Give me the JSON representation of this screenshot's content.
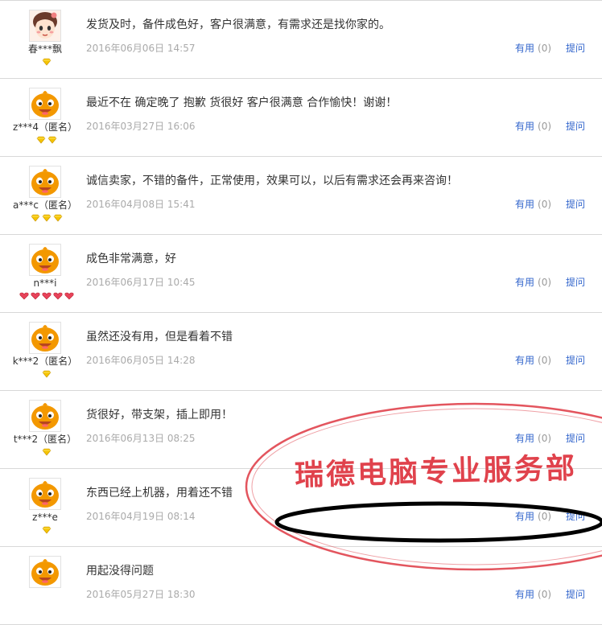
{
  "reviews": [
    {
      "avatar": "girl-avatar",
      "user": "春***飘",
      "content": "发货及时，备件成色好，客户很满意，有需求还是找你家的。",
      "time": "2016年06月06日 14:57",
      "useful_label": "有用",
      "useful_count": "(0)",
      "reply_label": "提问",
      "badge": "gold-diamond",
      "badge_count": 1
    },
    {
      "avatar": "orange-mascot-avatar",
      "user": "z***4（匿名）",
      "content": "最近不在 确定晚了 抱歉 货很好 客户很满意 合作愉快！谢谢！",
      "time": "2016年03月27日 16:06",
      "useful_label": "有用",
      "useful_count": "(0)",
      "reply_label": "提问",
      "badge": "gold-diamond",
      "badge_count": 2
    },
    {
      "avatar": "orange-mascot-avatar",
      "user": "a***c（匿名）",
      "content": "诚信卖家，不错的备件，正常使用，效果可以，以后有需求还会再来咨询！",
      "time": "2016年04月08日 15:41",
      "useful_label": "有用",
      "useful_count": "(0)",
      "reply_label": "提问",
      "badge": "gold-diamond",
      "badge_count": 3
    },
    {
      "avatar": "orange-mascot-avatar",
      "user": "n***i",
      "content": "成色非常满意，好",
      "time": "2016年06月17日 10:45",
      "useful_label": "有用",
      "useful_count": "(0)",
      "reply_label": "提问",
      "badge": "red-heart",
      "badge_count": 5
    },
    {
      "avatar": "orange-mascot-avatar",
      "user": "k***2（匿名）",
      "content": "虽然还没有用，但是看着不错",
      "time": "2016年06月05日 14:28",
      "useful_label": "有用",
      "useful_count": "(0)",
      "reply_label": "提问",
      "badge": "gold-diamond",
      "badge_count": 1
    },
    {
      "avatar": "orange-mascot-avatar",
      "user": "t***2（匿名）",
      "content": "货很好，带支架，插上即用！",
      "time": "2016年06月13日 08:25",
      "useful_label": "有用",
      "useful_count": "(0)",
      "reply_label": "提问",
      "badge": "gold-diamond",
      "badge_count": 1
    },
    {
      "avatar": "orange-mascot-avatar",
      "user": "z***e",
      "content": "东西已经上机器，用着还不错",
      "time": "2016年04月19日 08:14",
      "useful_label": "有用",
      "useful_count": "(0)",
      "reply_label": "提问",
      "badge": "gold-diamond",
      "badge_count": 1
    },
    {
      "avatar": "orange-mascot-avatar",
      "user": "",
      "content": "用起没得问题",
      "time": "2016年05月27日 18:30",
      "useful_label": "有用",
      "useful_count": "(0)",
      "reply_label": "提问",
      "badge": "gold-diamond",
      "badge_count": 0
    }
  ],
  "stamp": {
    "text": "瑞德电脑专业服务部",
    "color": "#e0424c"
  },
  "colors": {
    "link": "#3366cc",
    "time": "#aaaaaa",
    "divider": "#d8d8d8",
    "gold": "#f5c400",
    "red": "#e8435a",
    "mascot": "#f39800"
  }
}
